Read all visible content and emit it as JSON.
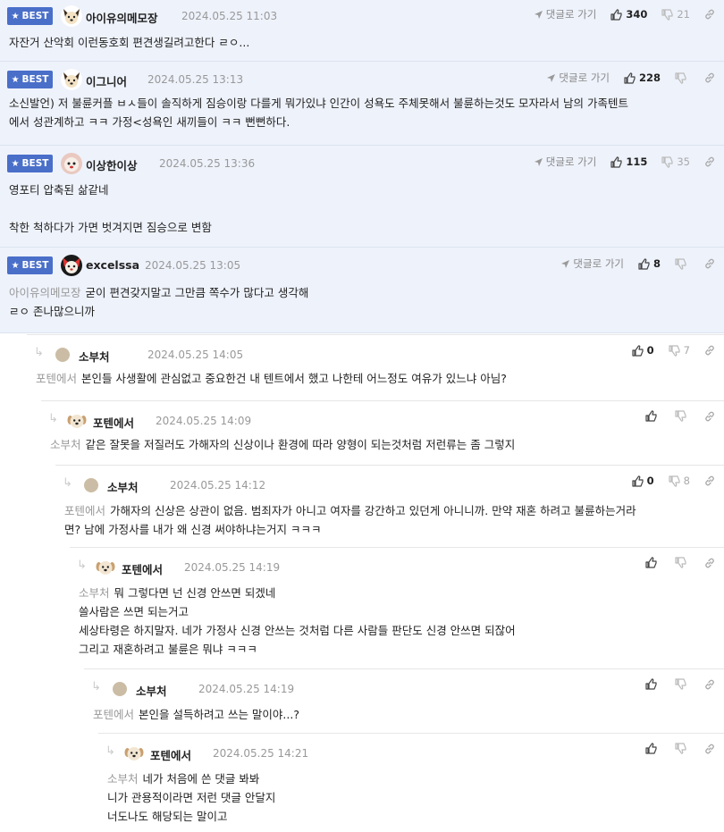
{
  "best_label": "BEST",
  "goto_label": "댓글로 가기",
  "best_comments": [
    {
      "nick": "아이유의메모장",
      "date": "2024.05.25 11:03",
      "up": "340",
      "down": "21",
      "mention": "",
      "lines": [
        "자잔거 산악회 이런동호회 편견생길려고한다 ㄹㅇ..."
      ]
    },
    {
      "nick": "이그니어",
      "date": "2024.05.25 13:13",
      "up": "228",
      "down": "",
      "mention": "",
      "lines": [
        "소신발언) 저 불륜커플 ㅂㅅ들이 솔직하게 짐승이랑 다를게 뭐가있냐 인간이 성욕도 주체못해서 불륜하는것도 모자라서 남의 가족텐트",
        "에서 성관계하고 ㅋㅋ 가정<성욕인 새끼들이 ㅋㅋ 뻔뻔하다."
      ]
    },
    {
      "nick": "이상한이상",
      "date": "2024.05.25 13:36",
      "up": "115",
      "down": "35",
      "mention": "",
      "lines": [
        "영포티 압축된 삶같네",
        "",
        "착한 척하다가 가면 벗겨지면 짐승으로 변함"
      ]
    },
    {
      "nick": "excelssa",
      "date": "2024.05.25 13:05",
      "up": "8",
      "down": "",
      "mention": "아이유의메모장",
      "lines": [
        "굳이 편견갖지말고 그만큼 쪽수가 많다고 생각해",
        "ㄹㅇ 존나많으니까"
      ]
    }
  ],
  "replies": [
    {
      "nick": "소부처",
      "date": "2024.05.25 14:05",
      "up": "0",
      "down": "7",
      "mention": "포텐에서",
      "lines": [
        "본인들 사생활에 관심없고 중요한건 내 텐트에서 했고 나한테 어느정도 여유가 있느냐 아님?"
      ]
    },
    {
      "nick": "포텐에서",
      "date": "2024.05.25 14:09",
      "up": "",
      "down": "",
      "mention": "소부처",
      "lines": [
        "같은 잘못을 저질러도 가해자의 신상이나 환경에 따라 양형이 되는것처럼 저런류는 좀 그렇지"
      ]
    },
    {
      "nick": "소부처",
      "date": "2024.05.25 14:12",
      "up": "0",
      "down": "8",
      "mention": "포텐에서",
      "lines": [
        "가해자의 신상은 상관이 없음. 범죄자가 아니고 여자를 강간하고 있던게 아니니까. 만약 재혼 하려고 불륜하는거라",
        "면? 남에 가정사를 내가 왜 신경 써야하냐는거지 ㅋㅋㅋ"
      ]
    },
    {
      "nick": "포텐에서",
      "date": "2024.05.25 14:19",
      "up": "",
      "down": "",
      "mention": "소부처",
      "lines": [
        "뭐 그렇다면 넌 신경 안쓰면 되겠네",
        "쓸사람은 쓰면 되는거고",
        "세상타령은 하지말자. 네가 가정사 신경 안쓰는 것처럼 다른 사람들 판단도 신경 안쓰면 되잖어",
        "그리고 재혼하려고 불륜은 뭐냐 ㅋㅋㅋ"
      ]
    },
    {
      "nick": "소부처",
      "date": "2024.05.25 14:19",
      "up": "",
      "down": "",
      "mention": "포텐에서",
      "lines": [
        "본인을 설득하려고 쓰는 말이야...?"
      ]
    },
    {
      "nick": "포텐에서",
      "date": "2024.05.25 14:21",
      "up": "",
      "down": "",
      "mention": "소부처",
      "lines": [
        "네가 처음에 쓴 댓글 봐봐",
        "니가 관용적이라면 저런 댓글 안달지",
        "너도나도 해당되는 말이고"
      ]
    }
  ],
  "colors": {
    "best_bg": "#eef2fb",
    "badge": "#4a6fc9",
    "muted": "#999999"
  }
}
